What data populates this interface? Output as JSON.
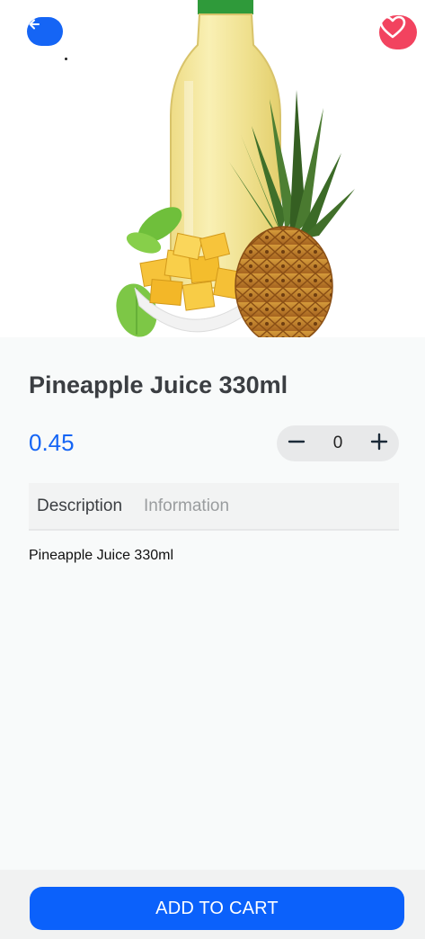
{
  "product": {
    "title": "Pineapple Juice 330ml",
    "price": "0.45",
    "quantity": "0",
    "description_text": "Pineapple Juice 330ml"
  },
  "tabs": [
    {
      "label": "Description",
      "active": true
    },
    {
      "label": "Information",
      "active": false
    }
  ],
  "actions": {
    "add_to_cart_label": "ADD TO CART"
  },
  "icons": {
    "back": "arrow-left-icon",
    "favorite": "heart-icon",
    "decrease": "minus-icon",
    "increase": "plus-icon"
  },
  "colors": {
    "accent": "#1565f5",
    "favorite": "#f2435f",
    "title": "#3b3e42",
    "button": "#0b61fb"
  }
}
